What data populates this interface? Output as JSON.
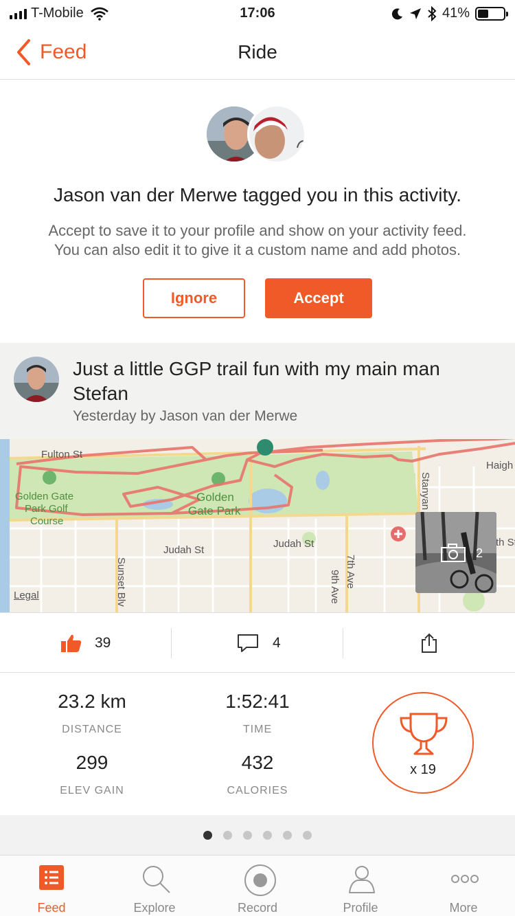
{
  "status_bar": {
    "carrier": "T-Mobile",
    "time": "17:06",
    "battery": "41%",
    "battery_level": 0.41
  },
  "nav": {
    "back_label": "Feed",
    "title": "Ride"
  },
  "tag": {
    "title": "Jason van der Merwe tagged you in this activity.",
    "subtitle_line1": "Accept to save it to your profile and show on your activity feed.",
    "subtitle_line2": "You can also edit it to give it a custom name and add photos.",
    "ignore_label": "Ignore",
    "accept_label": "Accept"
  },
  "activity": {
    "title": "Just a little GGP trail fun with my main man Stefan",
    "meta": "Yesterday by Jason van der Merwe"
  },
  "map": {
    "labels": {
      "fulton": "Fulton St",
      "golf1": "Golden Gate",
      "golf2": "Park Golf",
      "golf3": "Course",
      "ggp1": "Golden",
      "ggp2": "Gate Park",
      "judah1": "Judah St",
      "judah2": "Judah St",
      "sunset": "Sunset Blv",
      "seventh": "7th Ave",
      "ninth": "9th Ave",
      "stanyan": "Stanyan",
      "haight": "Haigh",
      "nth": "th St"
    },
    "legal": "Legal",
    "photo_count": "2"
  },
  "social": {
    "kudos": "39",
    "comments": "4"
  },
  "stats": {
    "distance": {
      "value": "23.2 km",
      "label": "DISTANCE"
    },
    "time": {
      "value": "1:52:41",
      "label": "TIME"
    },
    "elev": {
      "value": "299",
      "label": "ELEV GAIN"
    },
    "calories": {
      "value": "432",
      "label": "CALORIES"
    },
    "achievements": "x 19"
  },
  "pager": {
    "count": 6,
    "active": 0
  },
  "tabbar": {
    "feed": "Feed",
    "explore": "Explore",
    "record": "Record",
    "profile": "Profile",
    "more": "More"
  },
  "colors": {
    "accent": "#f05a28",
    "route": "#e8736b",
    "park": "#cfe6b5"
  },
  "icons": [
    "chevron-left-icon",
    "wifi-icon",
    "moon-icon",
    "location-icon",
    "bluetooth-icon",
    "thumbs-up-icon",
    "comment-icon",
    "share-icon",
    "trophy-icon",
    "camera-icon",
    "feed-icon",
    "search-icon",
    "record-icon",
    "person-icon",
    "more-icon"
  ]
}
